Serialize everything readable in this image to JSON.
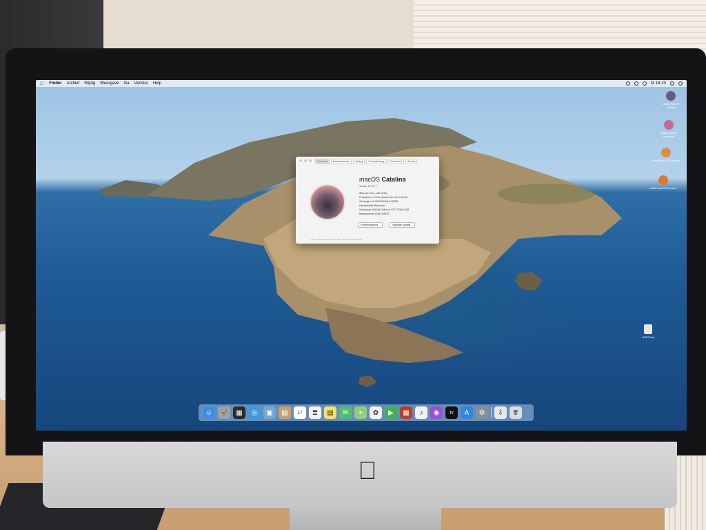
{
  "menubar": {
    "apple": "",
    "items": [
      "Finder",
      "Archief",
      "Wijzig",
      "Weergave",
      "Ga",
      "Venster",
      "Help"
    ],
    "clock": "Di 16:23"
  },
  "about_window": {
    "tabs": [
      "Overzicht",
      "Beeldschermen",
      "Opslag",
      "Ondersteuning",
      "Onderhoud",
      "Service"
    ],
    "os_name_light": "macOS",
    "os_name_bold": "Catalina",
    "version": "Versie 10.15.7",
    "specs": [
      "iMac (27-inch, Late 2013)",
      "Processor  3,4 GHz Quad-Core Intel Core i5",
      "Geheugen  16 GB 1600 MHz DDR3",
      "Opstartschijf  Macintosh",
      "Videokaart  NVIDIA GeForce GTX 775M 2 GB",
      "Serienummer  D25LH0EFR..."
    ],
    "button_report": "Systeemrapport...",
    "button_update": "Software-update...",
    "footer": "™ en © 1983-2020 Apple Inc. Alle rechten voorbehouden."
  },
  "desktop_icons": [
    {
      "label": "Install macOS Catalina",
      "color": "#6a5a80"
    },
    {
      "label": "Install macOS Monterey",
      "color": "#c66a9a"
    },
    {
      "label": "Install macOS Ventura",
      "color": "#d9903a"
    },
    {
      "label": "Install macOS Ventura",
      "color": "#e07a2a"
    },
    {
      "label": "USB Data",
      "color": "#e6e6e6"
    }
  ],
  "dock": {
    "items": [
      {
        "name": "Finder",
        "color": "#3d8ee6",
        "glyph": "☺"
      },
      {
        "name": "Launchpad",
        "color": "#9aa3ad",
        "glyph": "🚀"
      },
      {
        "name": "Mission Control",
        "color": "#2b2b2b",
        "glyph": "▦"
      },
      {
        "name": "Safari",
        "color": "#3b9be0",
        "glyph": "◎"
      },
      {
        "name": "Preview",
        "color": "#6fa8d8",
        "glyph": "▣"
      },
      {
        "name": "Contacts",
        "color": "#c8a06a",
        "glyph": "▤"
      },
      {
        "name": "Calendar",
        "color": "#ffffff",
        "glyph": "17"
      },
      {
        "name": "Reminders",
        "color": "#f4f4f4",
        "glyph": "≣"
      },
      {
        "name": "Notes",
        "color": "#f7df6a",
        "glyph": "▤"
      },
      {
        "name": "Messages",
        "color": "#4cc36a",
        "glyph": "✉"
      },
      {
        "name": "Maps",
        "color": "#8fcf7a",
        "glyph": "⌖"
      },
      {
        "name": "Photos",
        "color": "#f2f2f2",
        "glyph": "✿"
      },
      {
        "name": "FaceTime",
        "color": "#3fb34f",
        "glyph": "▶"
      },
      {
        "name": "Photo Booth",
        "color": "#c0392b",
        "glyph": "▦"
      },
      {
        "name": "Music",
        "color": "#f2f2f2",
        "glyph": "♪"
      },
      {
        "name": "Podcasts",
        "color": "#9b4fd1",
        "glyph": "◉"
      },
      {
        "name": "TV",
        "color": "#111111",
        "glyph": "tv"
      },
      {
        "name": "App Store",
        "color": "#2f86e8",
        "glyph": "A"
      },
      {
        "name": "System Preferences",
        "color": "#8a8f96",
        "glyph": "⚙"
      },
      {
        "name": "Downloads",
        "color": "#e8e8e8",
        "glyph": "⇩"
      },
      {
        "name": "Trash",
        "color": "#d7dde3",
        "glyph": "🗑"
      }
    ]
  }
}
